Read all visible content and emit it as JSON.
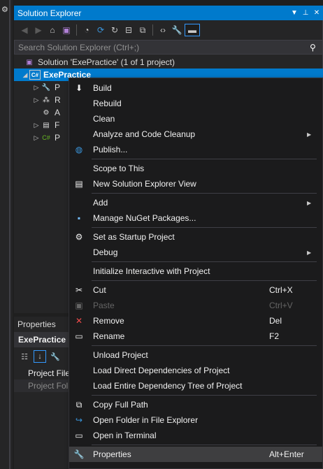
{
  "explorer": {
    "title": "Solution Explorer",
    "search_placeholder": "Search Solution Explorer (Ctrl+;)",
    "solution_label": "Solution 'ExePractice' (1 of 1 project)",
    "project_label": "ExePractice",
    "children": [
      {
        "label": "P",
        "icon": "wrench-icon"
      },
      {
        "label": "R",
        "icon": "references-icon"
      },
      {
        "label": "A",
        "icon": "config-icon"
      },
      {
        "label": "F",
        "icon": "form-icon"
      },
      {
        "label": "P",
        "icon": "csharp-file-icon"
      }
    ]
  },
  "properties": {
    "title": "Properties",
    "object": "ExePractice",
    "rows": [
      "Project File",
      "Project Fol"
    ]
  },
  "menu": {
    "items": [
      {
        "label": "Build",
        "icon": "build-icon"
      },
      {
        "label": "Rebuild"
      },
      {
        "label": "Clean"
      },
      {
        "label": "Analyze and Code Cleanup",
        "submenu": true
      },
      {
        "label": "Publish...",
        "icon": "globe-icon"
      },
      {
        "label": "Scope to This"
      },
      {
        "label": "New Solution Explorer View",
        "icon": "new-view-icon"
      },
      {
        "label": "Add",
        "submenu": true
      },
      {
        "label": "Manage NuGet Packages...",
        "icon": "nuget-icon"
      },
      {
        "label": "Set as Startup Project",
        "icon": "gear-icon"
      },
      {
        "label": "Debug",
        "submenu": true
      },
      {
        "label": "Initialize Interactive with Project"
      },
      {
        "label": "Cut",
        "icon": "scissors-icon",
        "shortcut": "Ctrl+X"
      },
      {
        "label": "Paste",
        "icon": "paste-icon",
        "shortcut": "Ctrl+V",
        "disabled": true
      },
      {
        "label": "Remove",
        "icon": "remove-icon",
        "shortcut": "Del"
      },
      {
        "label": "Rename",
        "icon": "rename-icon",
        "shortcut": "F2"
      },
      {
        "label": "Unload Project"
      },
      {
        "label": "Load Direct Dependencies of Project"
      },
      {
        "label": "Load Entire Dependency Tree of Project"
      },
      {
        "label": "Copy Full Path",
        "icon": "copy-icon"
      },
      {
        "label": "Open Folder in File Explorer",
        "icon": "open-folder-icon"
      },
      {
        "label": "Open in Terminal",
        "icon": "terminal-icon"
      },
      {
        "label": "Properties",
        "icon": "wrench-icon",
        "shortcut": "Alt+Enter"
      }
    ]
  },
  "colors": {
    "accent": "#007acc",
    "menu_bg": "#1b1b1c",
    "panel_bg": "#252526"
  }
}
